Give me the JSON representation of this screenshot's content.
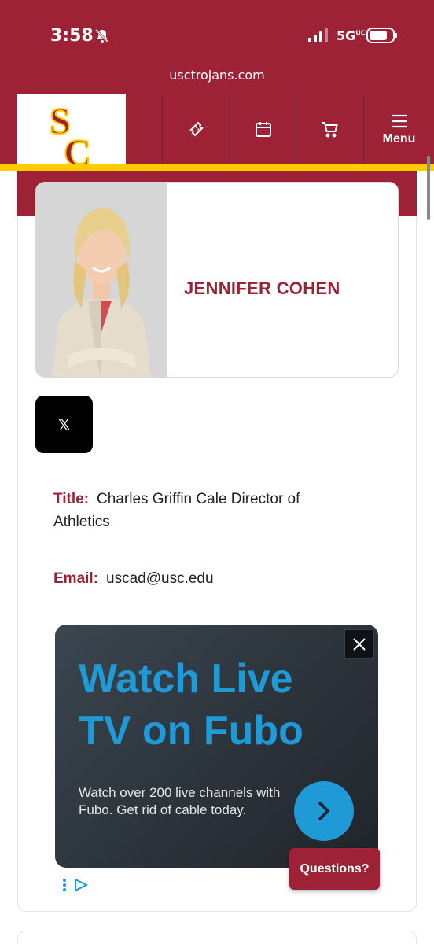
{
  "status_bar": {
    "time": "3:58",
    "network": "5G",
    "network_suffix": "UC"
  },
  "browser": {
    "url": "usctrojans.com"
  },
  "nav": {
    "logo_text": "SC",
    "menu_label": "Menu",
    "icons": [
      "ticket-icon",
      "calendar-icon",
      "cart-icon",
      "hamburger-icon"
    ]
  },
  "profile": {
    "name": "JENNIFER COHEN",
    "social": "𝕏",
    "title_label": "Title:",
    "title_value": "Charles Griffin Cale Director of Athletics",
    "email_label": "Email:",
    "email_value": "uscad@usc.edu"
  },
  "ad": {
    "headline": "Watch Live TV on Fubo",
    "body": "Watch over 200 live channels with Fubo. Get rid of cable today.",
    "sponsor": "Fubo"
  },
  "chat": {
    "label": "Questions?"
  },
  "colors": {
    "cardinal": "#9d2235",
    "gold": "#ffcc00",
    "fubo_blue": "#1f9ad6"
  }
}
